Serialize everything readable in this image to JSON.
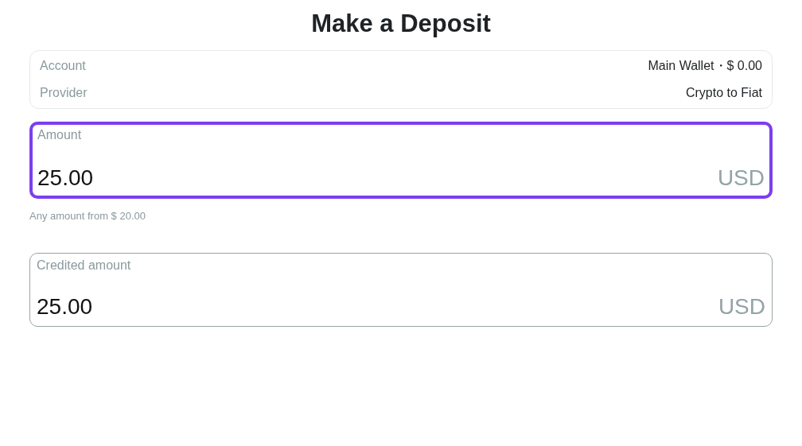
{
  "title": "Make a Deposit",
  "details": [
    {
      "label": "Account",
      "value": "Main Wallet・$ 0.00"
    },
    {
      "label": "Provider",
      "value": "Crypto to Fiat"
    }
  ],
  "fields": [
    {
      "label": "Amount",
      "value": "25.00",
      "currency": "USD",
      "focused": true,
      "hint": "Any amount from $ 20.00"
    },
    {
      "label": "Credited amount",
      "value": "25.00",
      "currency": "USD",
      "focused": false
    }
  ]
}
